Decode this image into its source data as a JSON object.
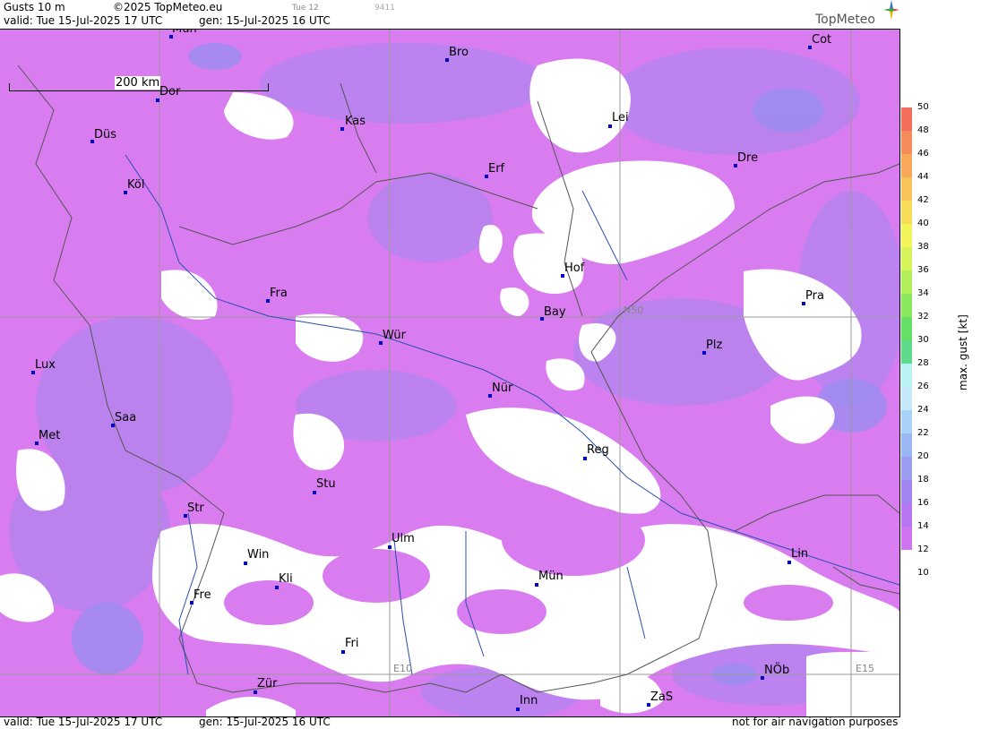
{
  "header": {
    "title": "Gusts 10 m",
    "copyright": "©2025 TopMeteo.eu",
    "day": "Tue 12",
    "code": "9411",
    "valid": "valid:  Tue  15-Jul-2025  17 UTC",
    "gen": "gen: 15-Jul-2025 16 UTC",
    "logo": "TopMeteo"
  },
  "footer": {
    "valid": "valid:  Tue  15-Jul-2025  17 UTC",
    "gen": "gen: 15-Jul-2025 16 UTC",
    "note": "not for air navigation purposes"
  },
  "scale_label": "200 km",
  "grid_labels": {
    "n50": "N50",
    "e10": "E10",
    "e15": "E15"
  },
  "cities": [
    "Mün",
    "Bro",
    "Cot",
    "Dor",
    "Kas",
    "Lei",
    "Düs",
    "Erf",
    "Dre",
    "Köl",
    "Hof",
    "Pra",
    "Fra",
    "Bay",
    "Würz",
    "Plz",
    "Lux",
    "Nür",
    "Saa",
    "Met",
    "Reg",
    "Stu",
    "Str",
    "Ulm",
    "Win",
    "Lin",
    "Kli",
    "Mün2",
    "Fre",
    "Fri",
    "NÖb",
    "Zür",
    "ZaS",
    "Inn"
  ],
  "city_labels": {
    "c0": "Mün",
    "c1": "Bro",
    "c2": "Cot",
    "c3": "Dor",
    "c4": "Kas",
    "c5": "Lei",
    "c6": "Düs",
    "c7": "Erf",
    "c8": "Dre",
    "c9": "Köl",
    "c10": "Hof",
    "c11": "Pra",
    "c12": "Fra",
    "c13": "Bay",
    "c14": "Wür",
    "c15": "Plz",
    "c16": "Lux",
    "c17": "Nür",
    "c18": "Saa",
    "c19": "Met",
    "c20": "Reg",
    "c21": "Stu",
    "c22": "Str",
    "c23": "Ulm",
    "c24": "Win",
    "c25": "Lin",
    "c26": "Kli",
    "c27": "Mün",
    "c28": "Fre",
    "c29": "Fri",
    "c30": "NÖb",
    "c31": "Zür",
    "c32": "ZaS",
    "c33": "Inn"
  },
  "legend": {
    "title": "max. gust [kt]",
    "ticks": [
      "50",
      "48",
      "46",
      "44",
      "42",
      "40",
      "38",
      "36",
      "34",
      "32",
      "30",
      "28",
      "26",
      "24",
      "22",
      "20",
      "18",
      "16",
      "14",
      "12",
      "10"
    ],
    "colors": [
      "#f26d5b",
      "#f58a5a",
      "#f7a85a",
      "#f8c35a",
      "#f7dc5a",
      "#f3f35a",
      "#d6f35a",
      "#b2ee5a",
      "#8ae85e",
      "#66df66",
      "#5fd98c",
      "#b8f2f5",
      "#c6e8fb",
      "#a8d2f7",
      "#9ab6f3",
      "#9a9cf0",
      "#a184ef",
      "#b676ef",
      "#cf74ef"
    ]
  }
}
